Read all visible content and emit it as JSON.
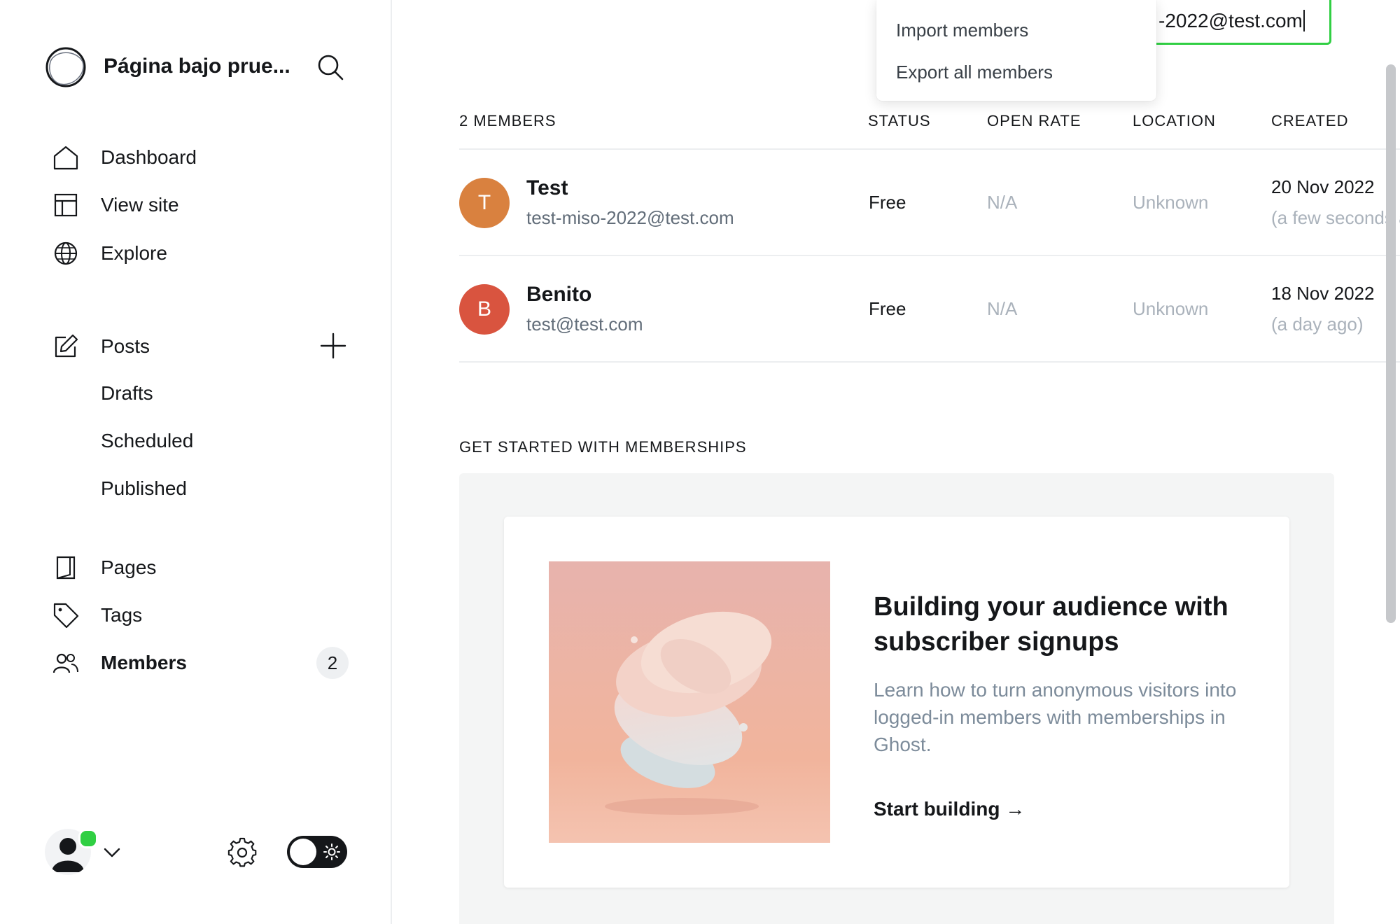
{
  "sidebar": {
    "site_title": "Página bajo prue...",
    "nav": [
      {
        "label": "Dashboard",
        "icon": "home-icon"
      },
      {
        "label": "View site",
        "icon": "layout-icon"
      },
      {
        "label": "Explore",
        "icon": "globe-icon"
      }
    ],
    "posts": {
      "label": "Posts",
      "icon": "edit-icon",
      "subitems": [
        "Drafts",
        "Scheduled",
        "Published"
      ]
    },
    "pages_label": "Pages",
    "tags_label": "Tags",
    "members_label": "Members",
    "members_count": "2"
  },
  "search": {
    "value": "-2022@test.com"
  },
  "actions_menu": {
    "items": [
      "Import members",
      "Export all members"
    ]
  },
  "table": {
    "headers": {
      "members": "2 MEMBERS",
      "status": "STATUS",
      "open_rate": "OPEN RATE",
      "location": "LOCATION",
      "created": "CREATED"
    },
    "rows": [
      {
        "initial": "T",
        "name": "Test",
        "email": "test-miso-2022@test.com",
        "status": "Free",
        "open_rate": "N/A",
        "location": "Unknown",
        "created": "20 Nov 2022",
        "created_ago": "(a few seconds ago)",
        "color": "#d9813f"
      },
      {
        "initial": "B",
        "name": "Benito",
        "email": "test@test.com",
        "status": "Free",
        "open_rate": "N/A",
        "location": "Unknown",
        "created": "18 Nov 2022",
        "created_ago": "(a day ago)",
        "color": "#d9543f"
      }
    ]
  },
  "get_started": {
    "title": "GET STARTED WITH MEMBERSHIPS",
    "heading": "Building your audience with subscriber signups",
    "text": "Learn how to turn anonymous visitors into logged-in members with memberships in Ghost.",
    "link": "Start building →"
  },
  "colors": {
    "accent_green": "#30cf43",
    "text_primary": "#15171a",
    "text_muted": "#aab2bb"
  }
}
